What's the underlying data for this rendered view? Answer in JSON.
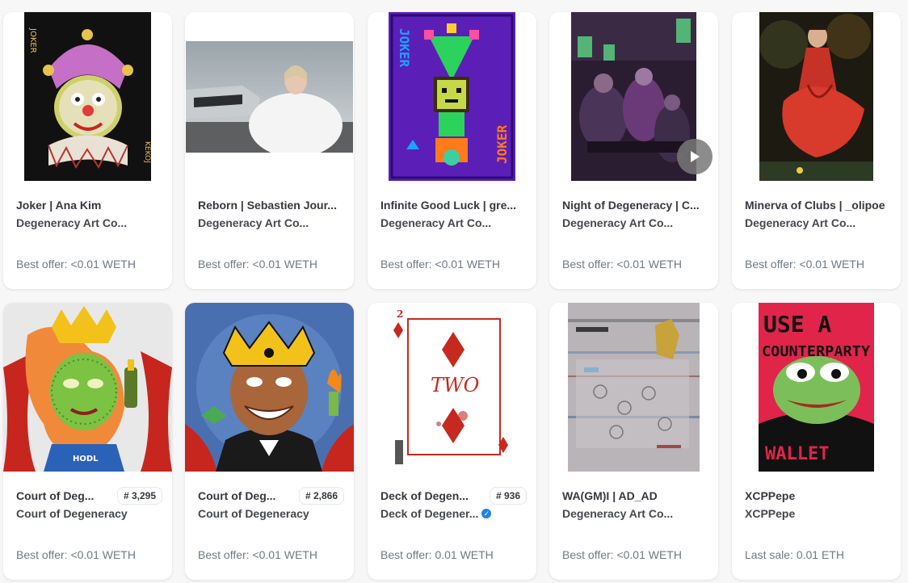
{
  "cards": [
    {
      "title": "Joker | Ana Kim",
      "collection": "Degeneracy Art Co...",
      "price": "Best offer: <0.01 WETH",
      "image_icon": "joker-clown-artwork"
    },
    {
      "title": "Reborn | Sebastien Jour...",
      "collection": "Degeneracy Art Co...",
      "price": "Best offer: <0.01 WETH",
      "image_icon": "woman-in-feathers-plane-wreck-photo"
    },
    {
      "title": "Infinite Good Luck | gre...",
      "collection": "Degeneracy Art Co...",
      "price": "Best offer: <0.01 WETH",
      "image_icon": "pixel-joker-card"
    },
    {
      "title": "Night of Degeneracy | C...",
      "collection": "Degeneracy Art Co...",
      "price": "Best offer: <0.01 WETH",
      "image_icon": "poker-night-scene",
      "has_video": true
    },
    {
      "title": "Minerva of Clubs | _olipoe",
      "collection": "Degeneracy Art Co...",
      "price": "Best offer: <0.01 WETH",
      "image_icon": "woman-red-dress-painting"
    },
    {
      "title": "Court of Deg...",
      "badge": "# 3,295",
      "collection": "Court of Degeneracy",
      "price": "Best offer: <0.01 WETH",
      "image_icon": "green-queen-champagne"
    },
    {
      "title": "Court of Deg...",
      "badge": "# 2,866",
      "collection": "Court of Degeneracy",
      "price": "Best offer: <0.01 WETH",
      "image_icon": "crowned-boy-torch"
    },
    {
      "title": "Deck of Degen...",
      "badge": "# 936",
      "collection": "Deck of Degener...",
      "verified": true,
      "price": "Best offer: 0.01 WETH",
      "image_icon": "two-of-diamonds-card"
    },
    {
      "title": "WA(GM)I | AD_AD",
      "collection": "Degeneracy Art Co...",
      "price": "Best offer: <0.01 WETH",
      "image_icon": "glitch-abstract"
    },
    {
      "title": "XCPPepe",
      "collection": "XCPPepe",
      "price": "Last sale: 0.01 ETH",
      "image_icon": "pepe-counterparty-wallet",
      "image_text_1": "USE A",
      "image_text_2": "COUNTERPARTY",
      "image_text_3": "WALLET"
    }
  ]
}
